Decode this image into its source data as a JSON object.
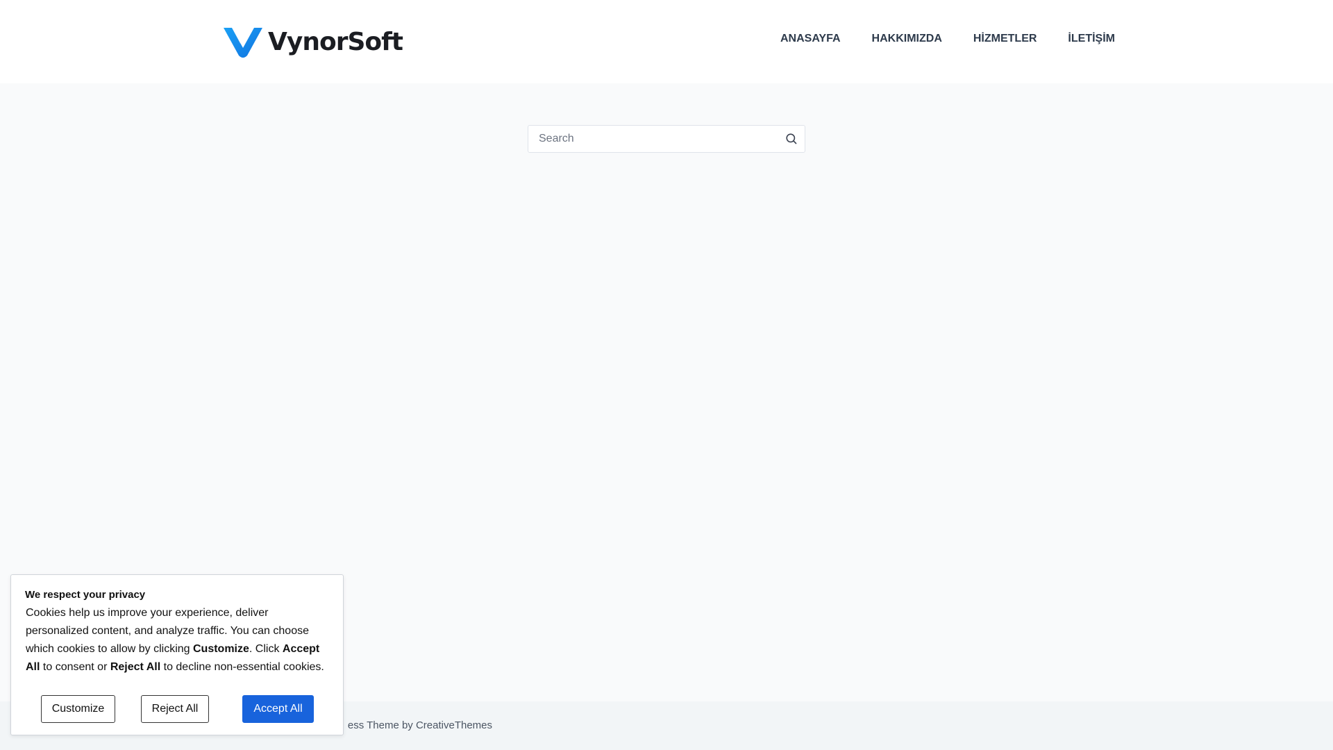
{
  "header": {
    "logo_text": "VynorSoft",
    "nav": [
      {
        "label": "ANASAYFA"
      },
      {
        "label": "HAKKIMIZDA"
      },
      {
        "label": "HİZMETLER"
      },
      {
        "label": "İLETİŞİM"
      }
    ]
  },
  "search": {
    "placeholder": "Search",
    "value": ""
  },
  "footer": {
    "visible_text": "ess Theme by CreativeThemes"
  },
  "cookie_banner": {
    "title": "We respect your privacy",
    "body": {
      "part1": "Cookies help us improve your experience, deliver personalized content, and analyze traffic. You can choose which cookies to allow by clicking ",
      "customize": "Customize",
      "part2": ". Click ",
      "accept_all": "Accept All",
      "part3": " to consent or ",
      "reject_all": "Reject All",
      "part4": " to decline non-essential cookies."
    },
    "buttons": {
      "customize": "Customize",
      "reject": "Reject All",
      "accept": "Accept All"
    }
  },
  "colors": {
    "brand_blue": "#1d8cf2",
    "accept_button": "#1863dc",
    "nav_text": "#2d3a4b",
    "page_background": "#f9fafb"
  },
  "icons": {
    "logo_mark": "v-logo-icon",
    "search": "search-icon"
  }
}
